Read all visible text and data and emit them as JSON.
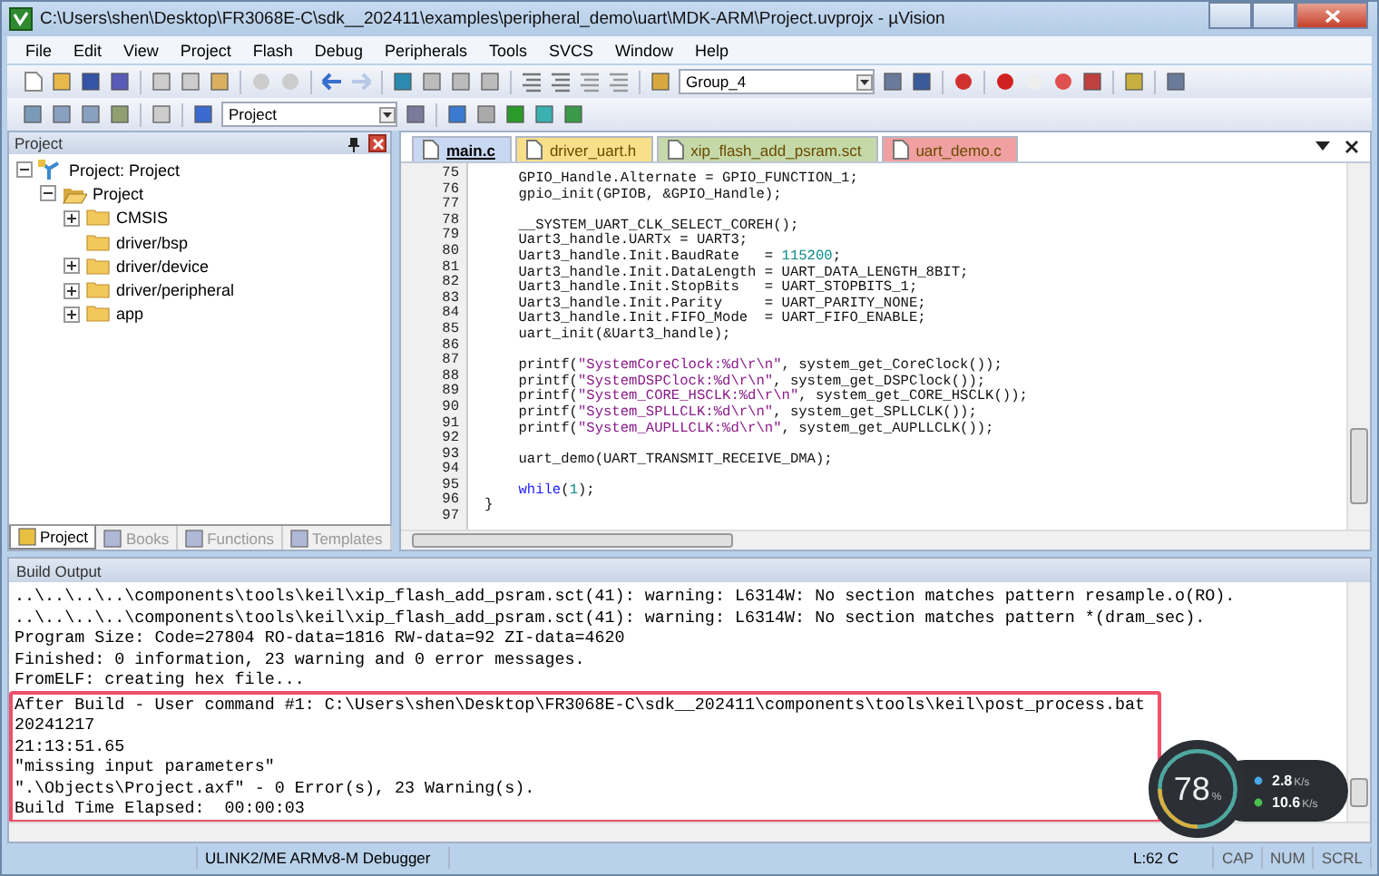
{
  "window": {
    "title": "C:\\Users\\shen\\Desktop\\FR3068E-C\\sdk__202411\\examples\\peripheral_demo\\uart\\MDK-ARM\\Project.uvprojx - µVision"
  },
  "menu": [
    "File",
    "Edit",
    "View",
    "Project",
    "Flash",
    "Debug",
    "Peripherals",
    "Tools",
    "SVCS",
    "Window",
    "Help"
  ],
  "toolbar": {
    "group_combo": "Group_4",
    "target_combo": "Project"
  },
  "project_panel": {
    "title": "Project",
    "tree": [
      {
        "label": "Project: Project",
        "kind": "root",
        "toggle": true,
        "expanded": true,
        "children": [
          {
            "label": "Project",
            "kind": "target",
            "toggle": true,
            "expanded": true,
            "children": [
              {
                "label": "CMSIS",
                "kind": "folder",
                "toggle": true,
                "expanded": false
              },
              {
                "label": "driver/bsp",
                "kind": "folder",
                "toggle": false
              },
              {
                "label": "driver/device",
                "kind": "folder",
                "toggle": true,
                "expanded": false
              },
              {
                "label": "driver/peripheral",
                "kind": "folder",
                "toggle": true,
                "expanded": false
              },
              {
                "label": "app",
                "kind": "folder",
                "toggle": true,
                "expanded": false
              }
            ]
          }
        ]
      }
    ],
    "tabs": [
      {
        "label": "Project",
        "selected": true
      },
      {
        "label": "Books",
        "selected": false
      },
      {
        "label": "Functions",
        "selected": false
      },
      {
        "label": "Templates",
        "selected": false
      }
    ]
  },
  "editor": {
    "tabs": [
      {
        "label": "main.c",
        "selected": true,
        "color": "#c9d8f2"
      },
      {
        "label": "driver_uart.h",
        "selected": false,
        "color": "#f8e08a"
      },
      {
        "label": "xip_flash_add_psram.sct",
        "selected": false,
        "color": "#c5d9a8"
      },
      {
        "label": "uart_demo.c",
        "selected": false,
        "color": "#f0a0a0"
      }
    ],
    "lines": [
      {
        "number": "75",
        "segments": [
          {
            "kind": "plain",
            "text": "    GPIO_Handle.Alternate = GPIO_FUNCTION_1;"
          }
        ]
      },
      {
        "number": "76",
        "segments": [
          {
            "kind": "plain",
            "text": "    gpio_init(GPIOB, &GPIO_Handle);"
          }
        ]
      },
      {
        "number": "77"
      },
      {
        "number": "78",
        "segments": [
          {
            "kind": "plain",
            "text": "    __SYSTEM_UART_CLK_SELECT_COREH();"
          }
        ]
      },
      {
        "number": "79",
        "segments": [
          {
            "kind": "plain",
            "text": "    Uart3_handle.UARTx = UART3;"
          }
        ]
      },
      {
        "number": "80",
        "segments": [
          {
            "kind": "plain",
            "text": "    Uart3_handle.Init.BaudRate   = "
          },
          {
            "kind": "number",
            "text": "115200"
          },
          {
            "kind": "plain",
            "text": ";"
          }
        ]
      },
      {
        "number": "81",
        "segments": [
          {
            "kind": "plain",
            "text": "    Uart3_handle.Init.DataLength = UART_DATA_LENGTH_8BIT;"
          }
        ]
      },
      {
        "number": "82",
        "segments": [
          {
            "kind": "plain",
            "text": "    Uart3_handle.Init.StopBits   = UART_STOPBITS_1;"
          }
        ]
      },
      {
        "number": "83",
        "segments": [
          {
            "kind": "plain",
            "text": "    Uart3_handle.Init.Parity     = UART_PARITY_NONE;"
          }
        ]
      },
      {
        "number": "84",
        "segments": [
          {
            "kind": "plain",
            "text": "    Uart3_handle.Init.FIFO_Mode  = UART_FIFO_ENABLE;"
          }
        ]
      },
      {
        "number": "85",
        "segments": [
          {
            "kind": "plain",
            "text": "    uart_init(&Uart3_handle);"
          }
        ]
      },
      {
        "number": "86"
      },
      {
        "number": "87",
        "segments": [
          {
            "kind": "plain",
            "text": "    printf("
          },
          {
            "kind": "string",
            "text": "\"SystemCoreClock:%d\\r\\n\""
          },
          {
            "kind": "plain",
            "text": ", system_get_CoreClock());"
          }
        ]
      },
      {
        "number": "88",
        "segments": [
          {
            "kind": "plain",
            "text": "    printf("
          },
          {
            "kind": "string",
            "text": "\"SystemDSPClock:%d\\r\\n\""
          },
          {
            "kind": "plain",
            "text": ", system_get_DSPClock());"
          }
        ]
      },
      {
        "number": "89",
        "segments": [
          {
            "kind": "plain",
            "text": "    printf("
          },
          {
            "kind": "string",
            "text": "\"System_CORE_HSCLK:%d\\r\\n\""
          },
          {
            "kind": "plain",
            "text": ", system_get_CORE_HSCLK());"
          }
        ]
      },
      {
        "number": "90",
        "segments": [
          {
            "kind": "plain",
            "text": "    printf("
          },
          {
            "kind": "string",
            "text": "\"System_SPLLCLK:%d\\r\\n\""
          },
          {
            "kind": "plain",
            "text": ", system_get_SPLLCLK());"
          }
        ]
      },
      {
        "number": "91",
        "segments": [
          {
            "kind": "plain",
            "text": "    printf("
          },
          {
            "kind": "string",
            "text": "\"System_AUPLLCLK:%d\\r\\n\""
          },
          {
            "kind": "plain",
            "text": ", system_get_AUPLLCLK());"
          }
        ]
      },
      {
        "number": "92"
      },
      {
        "number": "93",
        "segments": [
          {
            "kind": "plain",
            "text": "    uart_demo(UART_TRANSMIT_RECEIVE_DMA);"
          }
        ]
      },
      {
        "number": "94"
      },
      {
        "number": "95",
        "segments": [
          {
            "kind": "keyword",
            "text": "    while"
          },
          {
            "kind": "plain",
            "text": "("
          },
          {
            "kind": "number",
            "text": "1"
          },
          {
            "kind": "plain",
            "text": ");"
          }
        ]
      },
      {
        "number": "96",
        "segments": [
          {
            "kind": "plain",
            "text": "}"
          }
        ]
      },
      {
        "number": "97"
      }
    ]
  },
  "build_output": {
    "title": "Build Output",
    "lines": [
      {
        "text": "..\\..\\..\\..\\components\\tools\\keil\\xip_flash_add_psram.sct(41): warning: L6314W: No section matches pattern resample.o(RO).",
        "highlighted": false
      },
      {
        "text": "..\\..\\..\\..\\components\\tools\\keil\\xip_flash_add_psram.sct(41): warning: L6314W: No section matches pattern *(dram_sec).",
        "highlighted": false
      },
      {
        "text": "Program Size: Code=27804 RO-data=1816 RW-data=92 ZI-data=4620",
        "highlighted": false
      },
      {
        "text": "Finished: 0 information, 23 warning and 0 error messages.",
        "highlighted": false
      },
      {
        "text": "FromELF: creating hex file...",
        "highlighted": false
      },
      {
        "text": "After Build - User command #1: C:\\Users\\shen\\Desktop\\FR3068E-C\\sdk__202411\\components\\tools\\keil\\post_process.bat",
        "highlighted": true
      },
      {
        "text": "20241217",
        "highlighted": true
      },
      {
        "text": "21:13:51.65",
        "highlighted": true
      },
      {
        "text": "\"missing input parameters\"",
        "highlighted": true
      },
      {
        "text": "\".\\Objects\\Project.axf\" - 0 Error(s), 23 Warning(s).",
        "highlighted": true
      },
      {
        "text": "Build Time Elapsed:  00:00:03",
        "highlighted": true
      }
    ]
  },
  "status_bar": {
    "debugger": "ULINK2/ME ARMv8-M Debugger",
    "position": "L:62 C",
    "indicators": [
      "CAP",
      "NUM",
      "SCRL"
    ]
  },
  "monitor": {
    "cpu": "78",
    "cpu_unit": "%",
    "upload": "2.8",
    "upload_unit": "K/s",
    "download": "10.6",
    "download_unit": "K/s"
  }
}
